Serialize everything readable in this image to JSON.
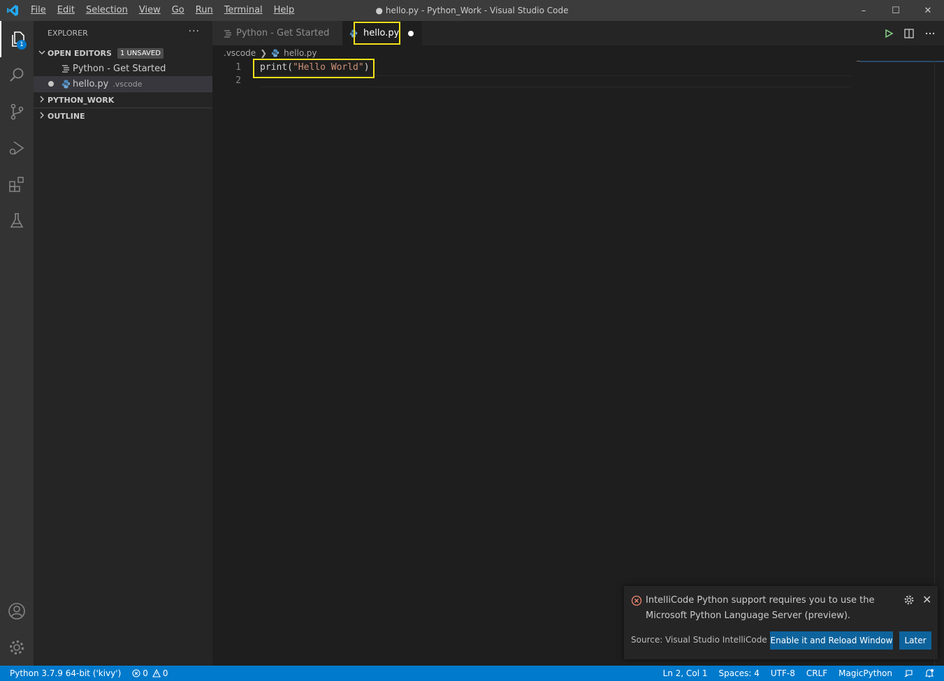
{
  "window": {
    "title": "● hello.py - Python_Work - Visual Studio Code",
    "minimize": "–",
    "maximize": "☐",
    "close": "✕"
  },
  "menu": [
    {
      "label": "File"
    },
    {
      "label": "Edit"
    },
    {
      "label": "Selection"
    },
    {
      "label": "View"
    },
    {
      "label": "Go"
    },
    {
      "label": "Run"
    },
    {
      "label": "Terminal"
    },
    {
      "label": "Help"
    }
  ],
  "activity_bar": {
    "explorer_badge": "1",
    "icons": [
      "explorer-icon",
      "search-icon",
      "source-control-icon",
      "run-debug-icon",
      "extensions-icon",
      "testing-icon"
    ],
    "bottom_icons": [
      "accounts-icon",
      "manage-gear-icon"
    ]
  },
  "sidebar": {
    "title": "EXPLORER",
    "more": "···",
    "open_editors": {
      "label": "OPEN EDITORS",
      "badge": "1 UNSAVED",
      "items": [
        {
          "name": "Python - Get Started",
          "desc": ""
        },
        {
          "name": "hello.py",
          "desc": ".vscode"
        }
      ]
    },
    "folder_label": "PYTHON_WORK",
    "outline_label": "OUTLINE"
  },
  "tabs": [
    {
      "label": "Python - Get Started",
      "active": false
    },
    {
      "label": "hello.py",
      "active": true,
      "dirty": true
    }
  ],
  "breadcrumb": {
    "folder": ".vscode",
    "separator": "❯",
    "file": "hello.py"
  },
  "editor": {
    "lines": [
      {
        "number": "1",
        "code_fn": "print(",
        "code_str": "\"Hello World\"",
        "code_end": ")"
      },
      {
        "number": "2"
      }
    ]
  },
  "notification": {
    "message": "IntelliCode Python support requires you to use the Microsoft Python Language Server (preview).",
    "source": "Source: Visual Studio IntelliCode (E...",
    "primary_button": "Enable it and Reload Window",
    "secondary_button": "Later",
    "close": "✕"
  },
  "status_bar": {
    "interpreter": "Python 3.7.9 64-bit ('kivy')",
    "errors": "0",
    "warnings": "0",
    "position": "Ln 2, Col 1",
    "spaces": "Spaces: 4",
    "encoding": "UTF-8",
    "eol": "CRLF",
    "language": "MagicPython"
  },
  "colors": {
    "accent": "#007acc",
    "highlight_box": "#f5e11a",
    "button": "#0e639c",
    "string": "#ce9178",
    "error": "#f48771"
  }
}
